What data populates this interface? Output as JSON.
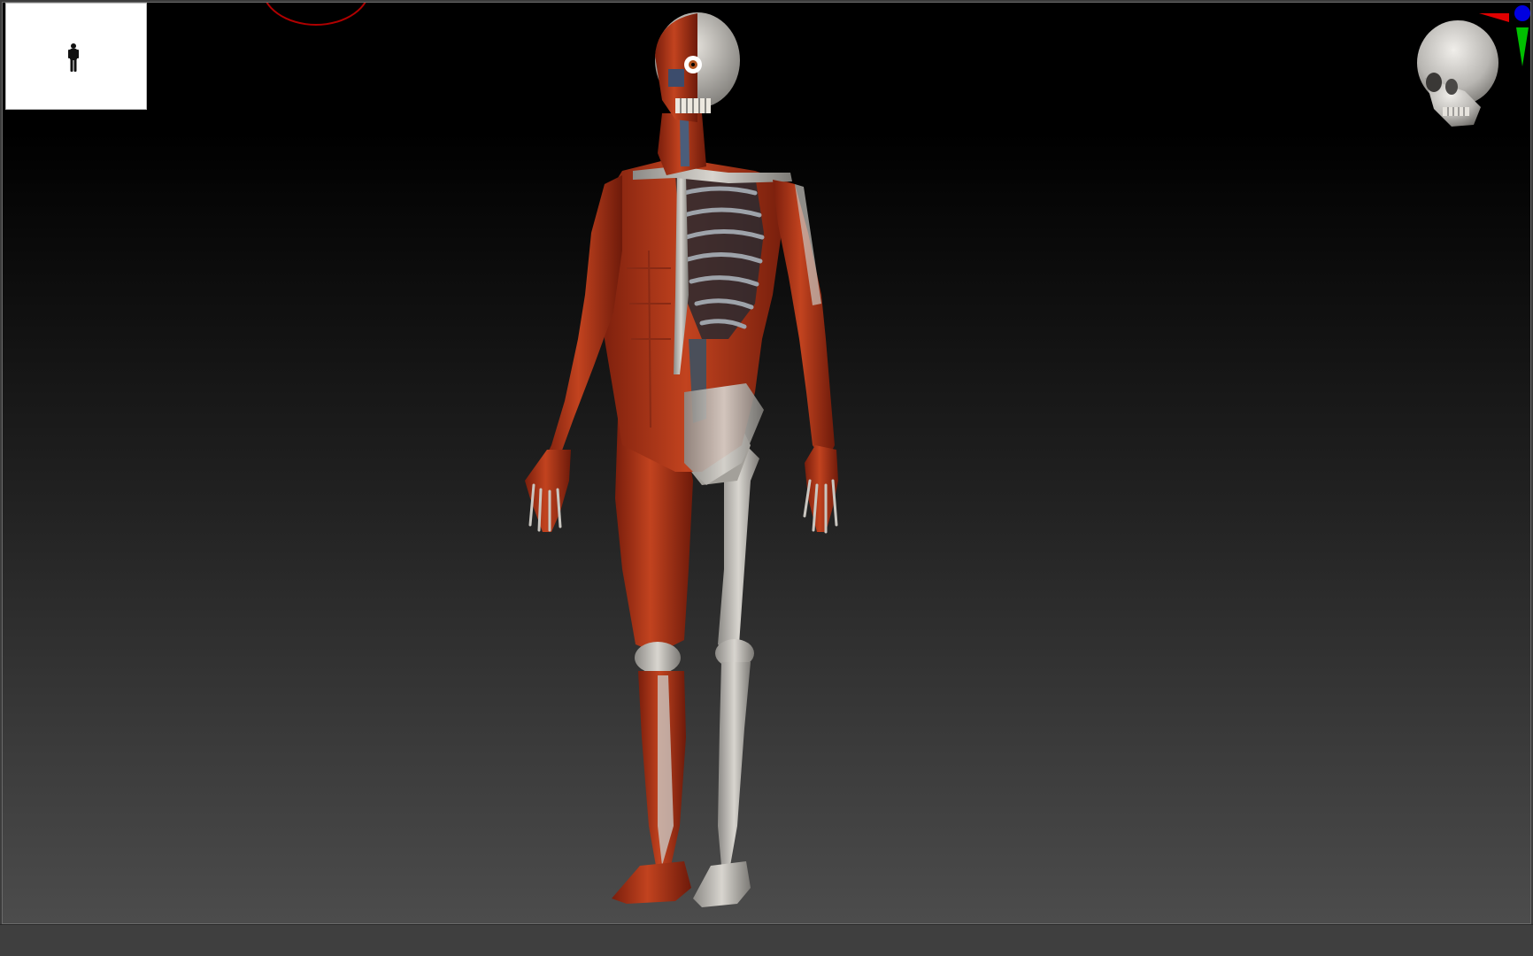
{
  "app": {
    "window_title": ""
  },
  "viewport": {
    "background_top": "#000000",
    "background_bottom": "#4c4c4c",
    "border_color": "#6a6a6a"
  },
  "navigator": {
    "icon": "human-figure-icon",
    "background": "#ffffff"
  },
  "brush_cursor": {
    "icon": "brush-ring-icon",
    "color": "#b00000"
  },
  "model": {
    "icon": "ecorche-anatomy-figure",
    "muscle_color": "#b53a1c",
    "bone_color": "#c9c6c0"
  },
  "orientation_gizmo": {
    "icon": "skull-gizmo-icon",
    "axis_x_color": "#e00000",
    "axis_y_color": "#00c000",
    "axis_z_color": "#0000e0"
  }
}
